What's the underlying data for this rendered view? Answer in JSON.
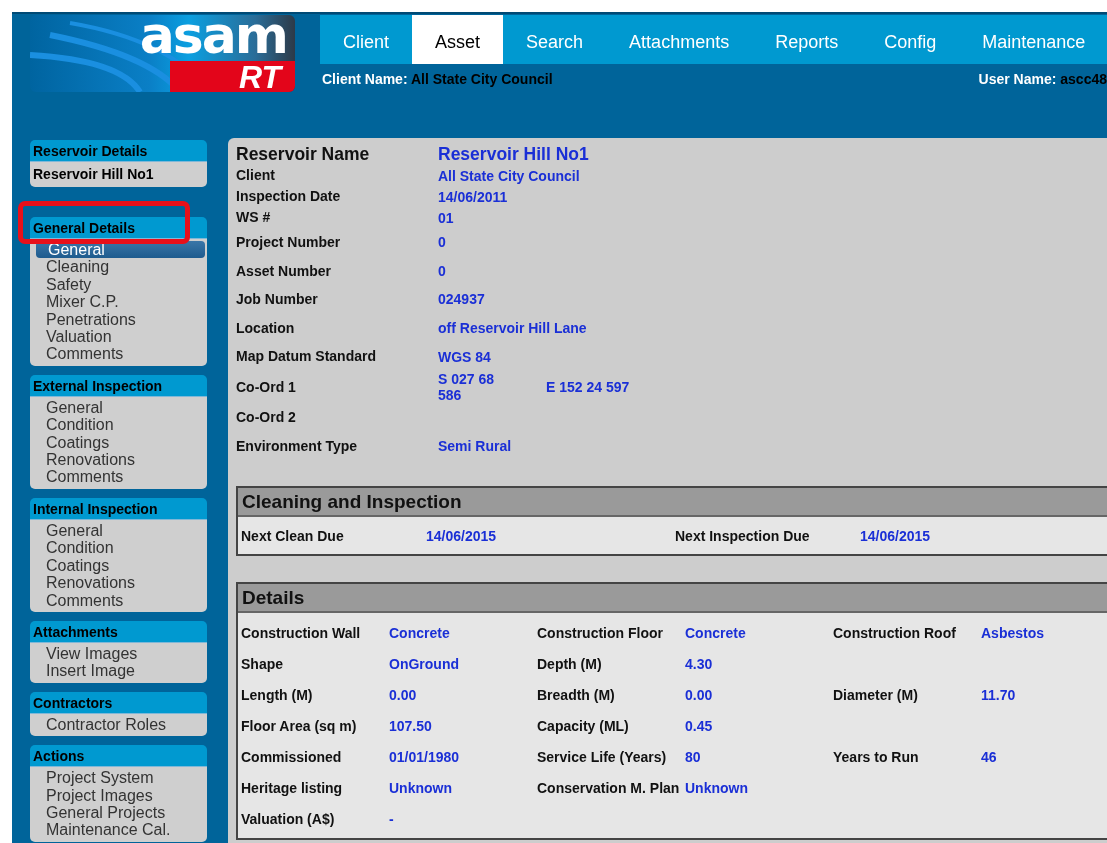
{
  "logo": {
    "wordmark": "asam",
    "tagline": "RT"
  },
  "nav": {
    "tabs": [
      {
        "label": "Client",
        "selected": false
      },
      {
        "label": "Asset",
        "selected": true
      },
      {
        "label": "Search",
        "selected": false
      },
      {
        "label": "Attachments",
        "selected": false
      },
      {
        "label": "Reports",
        "selected": false
      },
      {
        "label": "Config",
        "selected": false
      },
      {
        "label": "Maintenance",
        "selected": false
      }
    ]
  },
  "client_name": {
    "label": "Client Name:",
    "value": "All State City Council"
  },
  "user_name": {
    "label": "User Name:",
    "value": "ascc48"
  },
  "sidebar": {
    "groups": [
      {
        "title": "Reservoir Details",
        "kind": "summary",
        "highlighted": false,
        "items": [
          {
            "label": "Reservoir Hill No1"
          }
        ]
      },
      {
        "title": "General Details",
        "kind": "menu",
        "highlighted": true,
        "items": [
          {
            "label": "General",
            "selected": true
          },
          {
            "label": "Cleaning",
            "selected": false
          },
          {
            "label": "Safety",
            "selected": false
          },
          {
            "label": "Mixer C.P.",
            "selected": false
          },
          {
            "label": "Penetrations",
            "selected": false
          },
          {
            "label": "Valuation",
            "selected": false
          },
          {
            "label": "Comments",
            "selected": false
          }
        ]
      },
      {
        "title": "External Inspection",
        "kind": "menu",
        "highlighted": false,
        "items": [
          {
            "label": "General",
            "selected": false
          },
          {
            "label": "Condition",
            "selected": false
          },
          {
            "label": "Coatings",
            "selected": false
          },
          {
            "label": "Renovations",
            "selected": false
          },
          {
            "label": "Comments",
            "selected": false
          }
        ]
      },
      {
        "title": "Internal Inspection",
        "kind": "menu",
        "highlighted": false,
        "items": [
          {
            "label": "General",
            "selected": false
          },
          {
            "label": "Condition",
            "selected": false
          },
          {
            "label": "Coatings",
            "selected": false
          },
          {
            "label": "Renovations",
            "selected": false
          },
          {
            "label": "Comments",
            "selected": false
          }
        ]
      },
      {
        "title": "Attachments",
        "kind": "menu",
        "highlighted": false,
        "items": [
          {
            "label": "View Images",
            "selected": false
          },
          {
            "label": "Insert Image",
            "selected": false
          }
        ]
      },
      {
        "title": "Contractors",
        "kind": "menu",
        "highlighted": false,
        "items": [
          {
            "label": "Contractor Roles",
            "selected": false
          }
        ]
      },
      {
        "title": "Actions",
        "kind": "menu",
        "highlighted": false,
        "items": [
          {
            "label": "Project System",
            "selected": false
          },
          {
            "label": "Project Images",
            "selected": false
          },
          {
            "label": "General Projects",
            "selected": false
          },
          {
            "label": "Maintenance Cal.",
            "selected": false
          }
        ]
      }
    ]
  },
  "asset": {
    "title": {
      "label": "Reservoir Name",
      "value": "Reservoir Hill No1"
    },
    "fields": [
      {
        "label": "Client",
        "values": [
          "All State City Council"
        ]
      },
      {
        "label": "Inspection Date",
        "values": [
          "14/06/2011"
        ]
      },
      {
        "label": "WS #",
        "values": [
          "01"
        ]
      },
      {
        "label": "Project Number",
        "values": [
          "0"
        ]
      },
      {
        "label": "Asset Number",
        "values": [
          "0"
        ]
      },
      {
        "label": "Job Number",
        "values": [
          "024937"
        ]
      },
      {
        "label": "Location",
        "values": [
          "off Reservoir Hill Lane"
        ]
      },
      {
        "label": "Map Datum Standard",
        "values": [
          "WGS 84"
        ]
      },
      {
        "label": "Co-Ord 1",
        "values": [
          "S 027 68 586",
          "E 152 24 597"
        ]
      },
      {
        "label": "Co-Ord 2"
      },
      {
        "label": "Environment Type",
        "values": [
          "Semi Rural"
        ]
      }
    ]
  },
  "sections": [
    {
      "title": "Cleaning and Inspection",
      "rows": [
        [
          {
            "label": "Next Clean Due",
            "value": "14/06/2015"
          },
          {
            "label": "Next Inspection Due",
            "value": "14/06/2015"
          }
        ]
      ]
    },
    {
      "title": "Details",
      "rows": [
        [
          {
            "label": "Construction Wall",
            "value": "Concrete"
          },
          {
            "label": "Construction Floor",
            "value": "Concrete"
          },
          {
            "label": "Construction Roof",
            "value": "Asbestos"
          }
        ],
        [
          {
            "label": "Shape",
            "value": "OnGround"
          },
          {
            "label": "Depth (M)",
            "value": "4.30"
          }
        ],
        [
          {
            "label": "Length (M)",
            "value": "0.00"
          },
          {
            "label": "Breadth (M)",
            "value": "0.00"
          },
          {
            "label": "Diameter (M)",
            "value": "11.70"
          }
        ],
        [
          {
            "label": "Floor Area (sq m)",
            "value": "107.50"
          },
          {
            "label": "Capacity (ML)",
            "value": "0.45"
          }
        ],
        [
          {
            "label": "Commissioned",
            "value": "01/01/1980"
          },
          {
            "label": "Service Life (Years)",
            "value": "80"
          },
          {
            "label": "Years to Run",
            "value": "46"
          }
        ],
        [
          {
            "label": "Heritage listing",
            "value": "Unknown"
          },
          {
            "label": "Conservation M. Plan",
            "value": "Unknown"
          }
        ],
        [
          {
            "label": "Valuation (A$)",
            "value": "-"
          }
        ]
      ]
    }
  ]
}
